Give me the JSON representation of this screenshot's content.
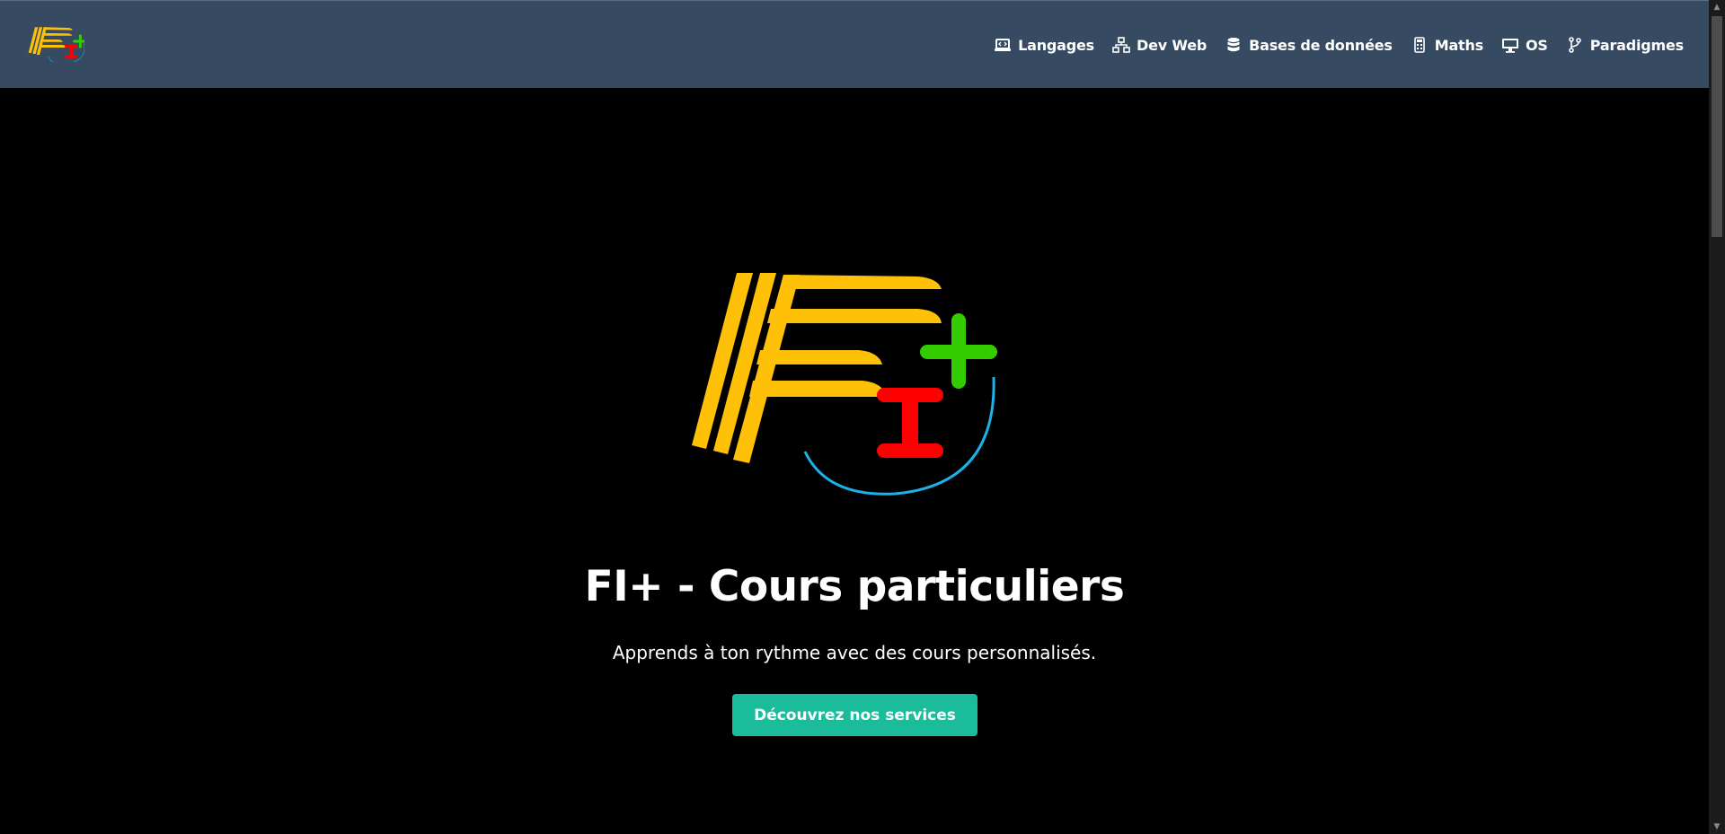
{
  "nav": {
    "logo_icon": "fi-plus-logo",
    "items": [
      {
        "label": "Langages",
        "icon": "laptop-code-icon"
      },
      {
        "label": "Dev Web",
        "icon": "sitemap-icon"
      },
      {
        "label": "Bases de données",
        "icon": "database-icon"
      },
      {
        "label": "Maths",
        "icon": "calculator-icon"
      },
      {
        "label": "OS",
        "icon": "desktop-icon"
      },
      {
        "label": "Paradigmes",
        "icon": "code-branch-icon"
      }
    ]
  },
  "hero": {
    "logo_icon": "fi-plus-logo",
    "title": "FI+ - Cours particuliers",
    "subtitle": "Apprends à ton rythme avec des cours personnalisés.",
    "cta_label": "Découvrez nos services"
  },
  "colors": {
    "navbar_bg": "#364b61",
    "page_bg": "#000000",
    "accent": "#1abc9c",
    "logo_yellow": "#ffc107",
    "logo_red": "#ff0000",
    "logo_green": "#33cc00",
    "logo_blue": "#1ab2e8"
  }
}
